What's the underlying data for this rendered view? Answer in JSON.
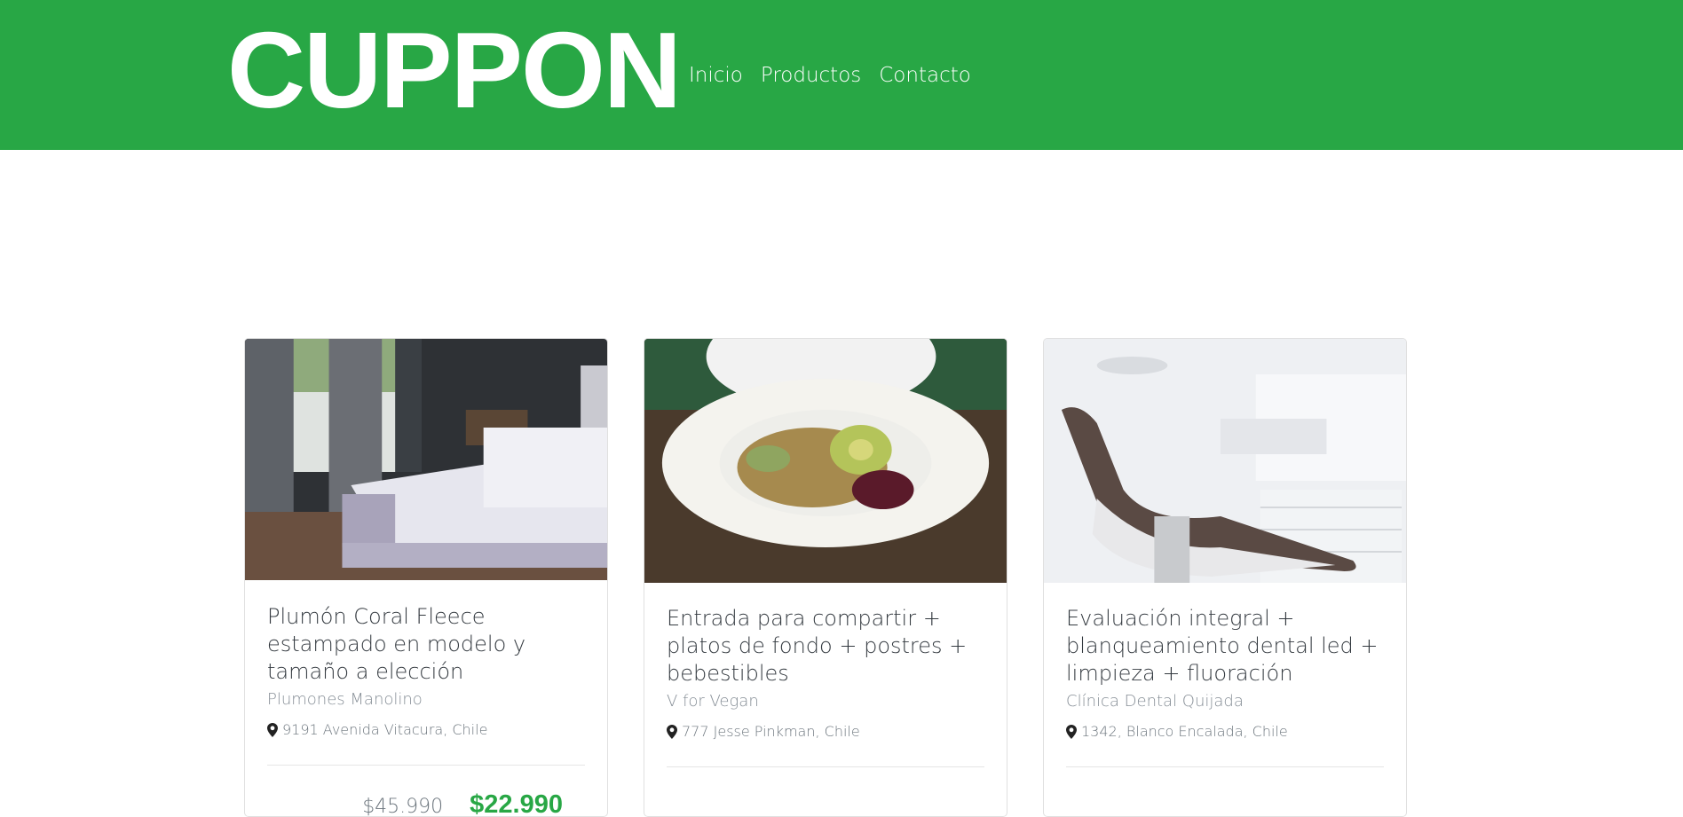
{
  "brand": {
    "logo_text": "CUPPON",
    "color": "#28a745"
  },
  "nav": {
    "items": [
      "Inicio",
      "Productos",
      "Contacto"
    ]
  },
  "products": [
    {
      "title": "Plumón Coral Fleece estampado en modelo y tamaño a elección",
      "company": "Plumones Manolino",
      "address": "9191 Avenida Vitacura, Chile",
      "old_price": "$45.990",
      "new_price": "$22.990"
    },
    {
      "title": "Entrada para compartir + platos de fondo + postres + bebestibles",
      "company": "V for Vegan",
      "address": "777 Jesse Pinkman, Chile"
    },
    {
      "title": "Evaluación integral + blanqueamiento dental led + limpieza + fluoración",
      "company": "Clínica Dental Quijada",
      "address": "1342, Blanco Encalada, Chile"
    }
  ],
  "icons": {
    "location": "map-pin-icon"
  }
}
